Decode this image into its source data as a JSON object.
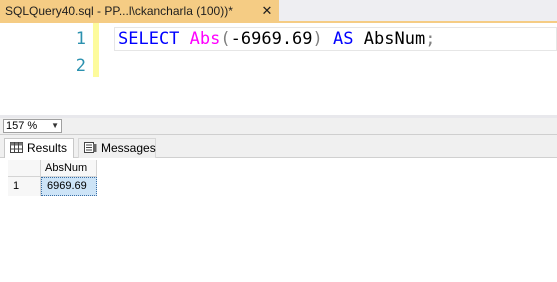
{
  "document_tab": {
    "title": "SQLQuery40.sql - PP...l\\ckancharla (100))*",
    "close_glyph": "✕",
    "accent_color": "#f5cc84"
  },
  "editor": {
    "line_numbers": [
      "1",
      "2"
    ],
    "code": {
      "keyword_select": "SELECT",
      "function_abs": "Abs",
      "paren_open": "(",
      "argument": "-6969.69",
      "paren_close": ")",
      "keyword_as": "AS",
      "alias": "AbsNum",
      "terminator": ";"
    },
    "colors": {
      "keyword": "#0000ff",
      "function": "#ff00ff",
      "line_number": "#2b91af"
    }
  },
  "zoom": {
    "value": "157 %",
    "arrow_icon": "chevron-down-icon"
  },
  "results_tabs": [
    {
      "label": "Results",
      "icon": "grid-icon",
      "active": true
    },
    {
      "label": "Messages",
      "icon": "messages-icon",
      "active": false
    }
  ],
  "grid": {
    "columns": [
      "AbsNum"
    ],
    "rows": [
      {
        "row_number": "1",
        "cells": [
          "6969.69"
        ]
      }
    ]
  }
}
